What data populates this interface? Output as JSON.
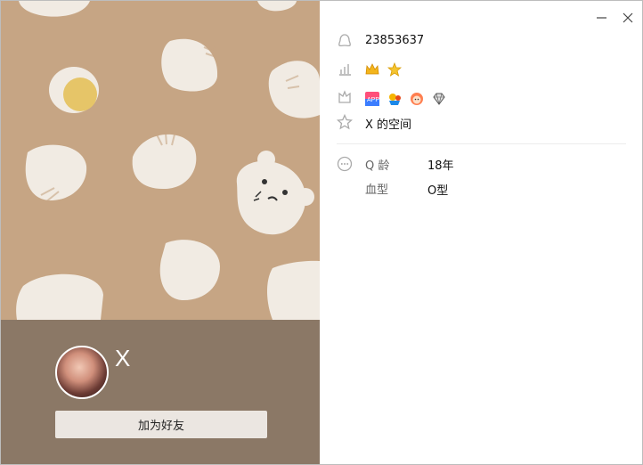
{
  "window": {
    "minimize_icon": "minimize-icon",
    "close_icon": "close-icon"
  },
  "profile": {
    "qq_number": "23853637",
    "nickname": "X",
    "add_friend_label": "加为好友",
    "space_link": "X 的空间"
  },
  "details": [
    {
      "label": "Q 龄",
      "value": "18年"
    },
    {
      "label": "血型",
      "value": "O型"
    }
  ],
  "level_icons": [
    "crown-icon",
    "star-icon"
  ],
  "badges": [
    "app-badge-icon",
    "game-badge-icon",
    "pet-badge-icon",
    "diamond-badge-icon"
  ],
  "colors": {
    "cover_background": "#c6a584",
    "bottom_background": "#8b7866",
    "button_background": "#ebe6e1"
  }
}
